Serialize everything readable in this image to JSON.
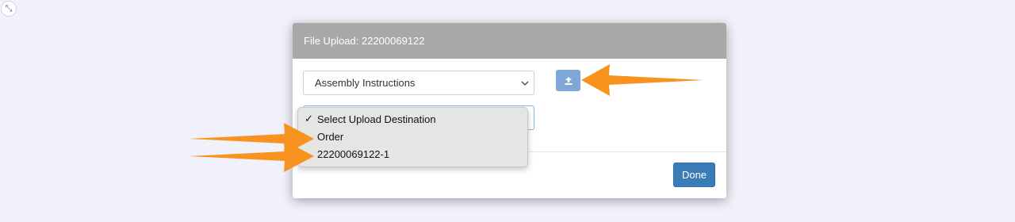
{
  "modal": {
    "title": "File Upload: 22200069122",
    "document_select": {
      "value": "Assembly Instructions"
    },
    "upload_button": {
      "icon": "upload-icon"
    },
    "done_label": "Done"
  },
  "dropdown": {
    "items": [
      {
        "label": "Select Upload Destination",
        "selected": true
      },
      {
        "label": "Order",
        "selected": false
      },
      {
        "label": "22200069122-1",
        "selected": false
      }
    ],
    "check_glyph": "✓"
  },
  "colors": {
    "page_bg": "#f1f1fb",
    "header_bg": "#a8a8a8",
    "upload_button": "#7fa7d6",
    "done_button": "#3a7cb8",
    "annotation_arrow": "#f7931e"
  }
}
